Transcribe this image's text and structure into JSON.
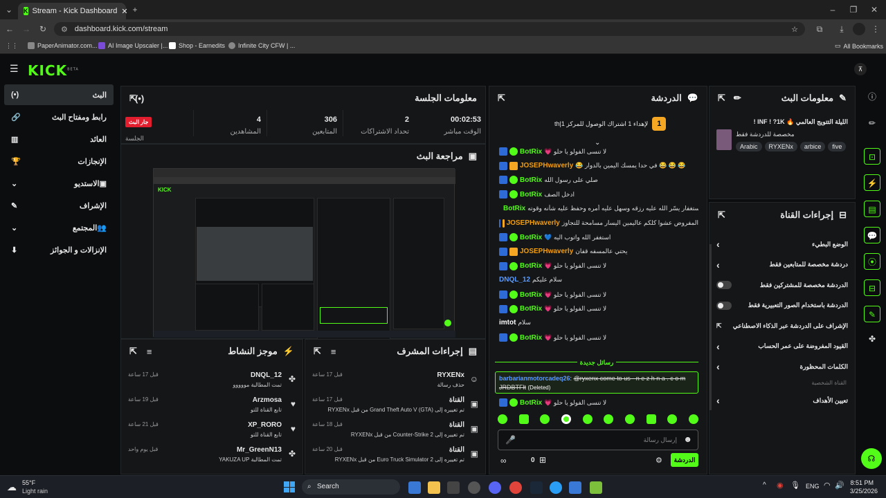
{
  "browser": {
    "tab_title": "Stream - Kick Dashboard",
    "url": "dashboard.kick.com/stream",
    "bookmarks": [
      "PaperAnimator.com...",
      "AI Image Upscaler |...",
      "Shop - Earnedits",
      "Infinite City CFW | ..."
    ],
    "all_bookmarks": "All Bookmarks"
  },
  "app": {
    "logo": "KICK",
    "logo_badge": "BETA"
  },
  "sidebar": {
    "items": [
      "البث",
      "رابط ومفتاح البث",
      "العائد",
      "الإنجازات",
      "الاستديو",
      "الإشراف",
      "المجتمع",
      "الإنزالات و الجوائز"
    ]
  },
  "session": {
    "title": "معلومات الجلسة",
    "live_badge": "جار البث",
    "session_label": "الجلسة",
    "stats": [
      {
        "value": "00:02:53",
        "label": "الوقت مباشر"
      },
      {
        "value": "2",
        "label": "تحداد الاشتراكات"
      },
      {
        "value": "306",
        "label": "المتابعين"
      },
      {
        "value": "4",
        "label": "المشاهدين"
      }
    ]
  },
  "preview": {
    "title": "مراجعة البث"
  },
  "activity": {
    "title": "موجز النشاط",
    "rows": [
      {
        "name": "DNQL_12",
        "sub": "تمت المطالبة مووووو",
        "time": "قبل 17 ساعة"
      },
      {
        "name": "Arzmosa",
        "sub": "تابع القناة للتو",
        "time": "قبل 19 ساعة"
      },
      {
        "name": "XP_RORO",
        "sub": "تابع القناة للتو",
        "time": "قبل 21 ساعة"
      },
      {
        "name": "Mr_GreenN13",
        "sub": "تمت المطالبة YAKUZA UP",
        "time": "قبل يوم واحد"
      }
    ]
  },
  "mod": {
    "title": "إجراءات المشرف",
    "rows": [
      {
        "name": "RYXENx",
        "sub": "حذف رسالة",
        "time": "قبل 17 ساعة"
      },
      {
        "name": "القناة",
        "sub": "تم تغييره إلى Grand Theft Auto V (GTA) من قبل RYXENx",
        "time": "قبل 17 ساعة"
      },
      {
        "name": "القناة",
        "sub": "تم تغييره إلى Counter-Strike 2 من قبل RYXENx",
        "time": "قبل 18 ساعة"
      },
      {
        "name": "القناة",
        "sub": "تم تغييره إلى Euro Truck Simulator 2 من قبل RYXENx",
        "time": "قبل 20 ساعة"
      }
    ]
  },
  "chat": {
    "title": "الدردشة",
    "pinned": "لإهداء 1 اشتراك الوصول للمركز 1|th",
    "pinned_rank": "1",
    "messages": [
      {
        "user": "BotRix",
        "c": "g",
        "text": "لا تنسى الفولو يا حلو 💗"
      },
      {
        "user": "JOSEPHwaverly",
        "c": "o",
        "text": "😂 😂 😂 في حدا يمسك اليمين بالدوار 😂"
      },
      {
        "user": "BotRix",
        "c": "g",
        "text": "صلي على رسول الله"
      },
      {
        "user": "BotRix",
        "c": "g",
        "text": "ادخل الصف"
      },
      {
        "user": "BotRix",
        "c": "g",
        "text": "من اتصف بصفة الاستغفار يسّر الله عليه رزقه وسهل عليه أمره وحفظ عليه شأنه وقوته"
      },
      {
        "user": "JOSEPHwaverly",
        "c": "o",
        "text": "المفروض عشوا كلكم عاليمين اليسار مسامحة للتجاوز"
      },
      {
        "user": "BotRix",
        "c": "g",
        "text": "استغفر الله واتوب اليه 💙"
      },
      {
        "user": "JOSEPHwaverly",
        "c": "o",
        "text": "يحتي عالمسفه قفان"
      },
      {
        "user": "BotRix",
        "c": "g",
        "text": "لا تنسى الفولو يا حلو 💗"
      },
      {
        "user": "DNQL_12",
        "c": "p",
        "text": "سلام عليكم"
      },
      {
        "user": "BotRix",
        "c": "g",
        "text": "لا تنسى الفولو يا حلو 💗"
      },
      {
        "user": "BotRix",
        "c": "g",
        "text": "لا تنسى الفولو يا حلو 💗"
      },
      {
        "user": "imtot",
        "c": "w",
        "text": "سلام"
      },
      {
        "user": "BotRix",
        "c": "g",
        "text": "لا تنسى الفولو يا حلو 💗"
      }
    ],
    "new_messages": "رسائل جديدة",
    "deleted_user": "barbarianmotorcadeq26",
    "deleted_text": "@ryxenx come to us - n e z h n a . c o m JRDBTFlt",
    "deleted_tag": "(Deleted)",
    "last": {
      "user": "BotRix",
      "text": "لا تنسى الفولو يا حلو 💗"
    },
    "input_placeholder": "إرسال رسالة",
    "send": "الدردشة",
    "count": "0"
  },
  "stream_info": {
    "title": "معلومات البث",
    "stream_title": "الليلة التتويج العالمي 🔥 INF ! ?1K !",
    "category": "مخصصة للدردشة فقط",
    "tags": [
      "Arabic",
      "RYXENx",
      "arbice",
      "five"
    ]
  },
  "channel": {
    "title": "إجراءات القناة",
    "items": [
      {
        "label": "الوضع البطيء",
        "ctrl": "chev"
      },
      {
        "label": "دردشة مخصصة للمتابعين فقط",
        "ctrl": "chev"
      },
      {
        "label": "الدردشة مخصصة للمشتركين فقط",
        "ctrl": "tog"
      },
      {
        "label": "الدردشة باستخدام الصور التعبيرية فقط",
        "ctrl": "tog"
      },
      {
        "label": "الإشراف على الدردشة عبر الذكاء الاصطناعي",
        "ctrl": "ext"
      },
      {
        "label": "القيود المفروضة على عمر الحساب",
        "ctrl": "chev"
      },
      {
        "label": "الكلمات المحظورة",
        "ctrl": "chev"
      }
    ],
    "section": "القناة الشخصية",
    "goal": "تعيين الأهداف"
  },
  "taskbar": {
    "weather_temp": "55°F",
    "weather_text": "Light rain",
    "search": "Search",
    "lang": "ENG",
    "time": "8:51 PM",
    "date": "3/25/2026"
  }
}
